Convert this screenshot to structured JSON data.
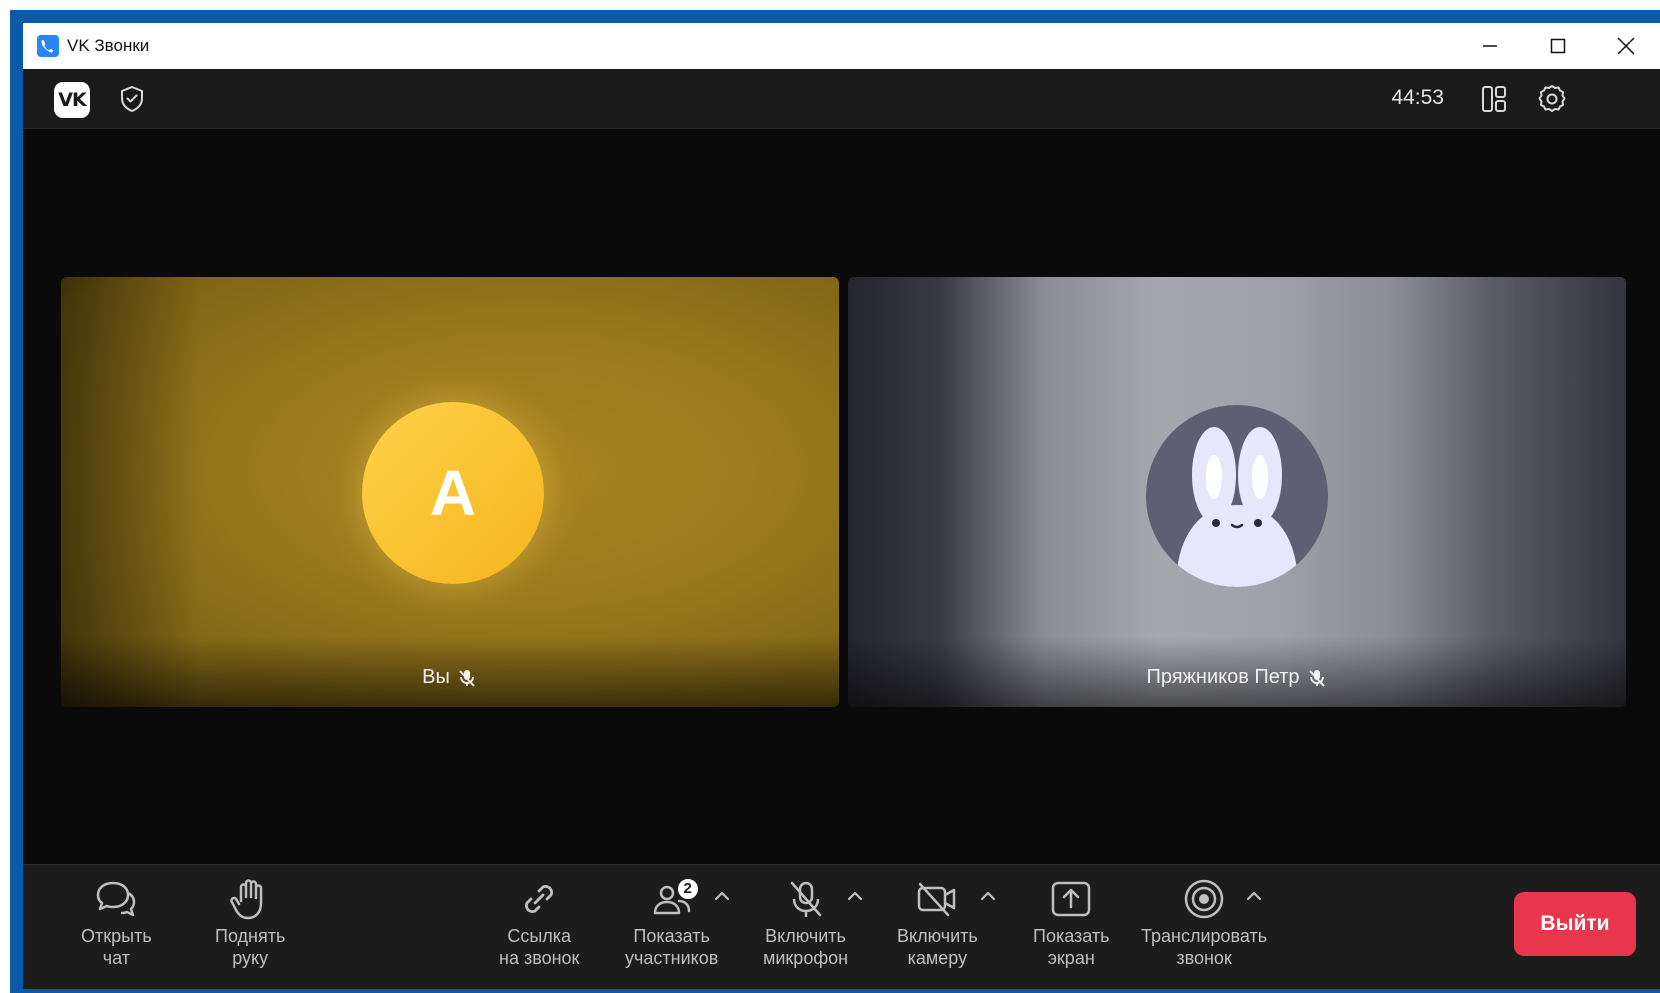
{
  "window": {
    "title": "VK Звонки"
  },
  "topbar": {
    "timer": "44:53"
  },
  "tiles": [
    {
      "name": "Вы",
      "avatar_letter": "A",
      "mic": "muted"
    },
    {
      "name": "Пряжников Петр",
      "avatar": "bunny",
      "mic": "muted"
    }
  ],
  "controls": {
    "open_chat": "Открыть\nчат",
    "raise_hand": "Поднять\nруку",
    "call_link": "Ссылка\nна звонок",
    "show_participants": "Показать\nучастников",
    "participants_count": "2",
    "enable_mic": "Включить\nмикрофон",
    "enable_camera": "Включить\nкамеру",
    "share_screen": "Показать\nэкран",
    "broadcast": "Транслировать\nзвонок",
    "exit": "Выйти"
  },
  "colors": {
    "exit_button": "#e8364c",
    "you_avatar": "#f5b51e",
    "bunny_background": "#5f5f73"
  }
}
